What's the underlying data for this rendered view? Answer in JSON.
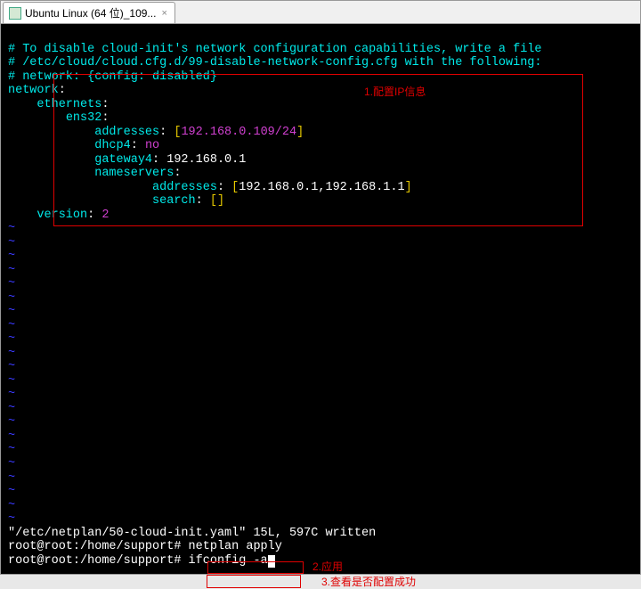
{
  "tab": {
    "title": "Ubuntu Linux (64 位)_109..."
  },
  "comments": {
    "c1": "# To disable cloud-init's network configuration capabilities, write a file",
    "c2": "# /etc/cloud/cloud.cfg.d/99-disable-network-config.cfg with the following:",
    "c3": "# network: {config: disabled}"
  },
  "yaml": {
    "network": "network",
    "ethernets": "ethernets",
    "ens32": "ens32",
    "addresses": "addresses",
    "addr_val": "192.168.0.109/24",
    "dhcp4": "dhcp4",
    "dhcp4_val": "no",
    "gateway4": "gateway4",
    "gateway4_val": "192.168.0.1",
    "nameservers": "nameservers",
    "ns_addresses": "addresses",
    "ns_addr_val": "192.168.0.1,192.168.1.1",
    "search": "search",
    "version": "version",
    "version_val": "2"
  },
  "status": {
    "file_line": "\"/etc/netplan/50-cloud-init.yaml\" 15L, 597C written",
    "prompt1": "root@root:/home/support# ",
    "cmd1": "netplan apply",
    "prompt2": "root@root:/home/support# ",
    "cmd2": "ifconfig -a"
  },
  "annotations": {
    "a1": "1.配置IP信息",
    "a2": "2.应用",
    "a3": "3.查看是否配置成功"
  }
}
